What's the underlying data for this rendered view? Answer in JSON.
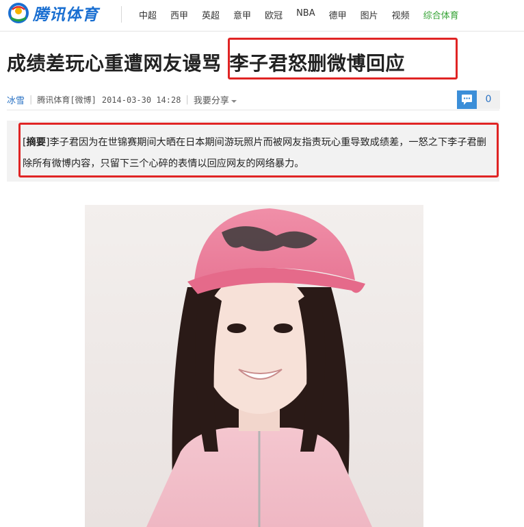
{
  "site": {
    "logo_text": "腾讯体育",
    "nav": [
      "中超",
      "西甲",
      "英超",
      "意甲",
      "欧冠",
      "NBA",
      "德甲",
      "图片",
      "视频",
      "综合体育"
    ]
  },
  "article": {
    "title_part1": "成绩差玩心重遭网友谩骂",
    "title_part2": "李子君怒删微博回应",
    "author": "冰雪",
    "source": "腾讯体育[微博]",
    "datetime": "2014-03-30 14:28",
    "share_label": "我要分享",
    "comment_count": "0",
    "summary_bracket_open": "[",
    "summary_label": "摘要",
    "summary_bracket_close": "]",
    "summary_text": "李子君因为在世锦赛期间大晒在日本期间游玩照片而被网友指责玩心重导致成绩差，一怒之下李子君删除所有微博内容，只留下三个心碎的表情以回应网友的网络暴力。"
  },
  "colors": {
    "brand_blue": "#1a6fd1",
    "highlight_red": "#e02424",
    "nav_green": "#35a335",
    "link_blue": "#2a72c4"
  },
  "icons": [
    "tencent-logo-icon",
    "comment-icon",
    "share-caret-icon"
  ]
}
